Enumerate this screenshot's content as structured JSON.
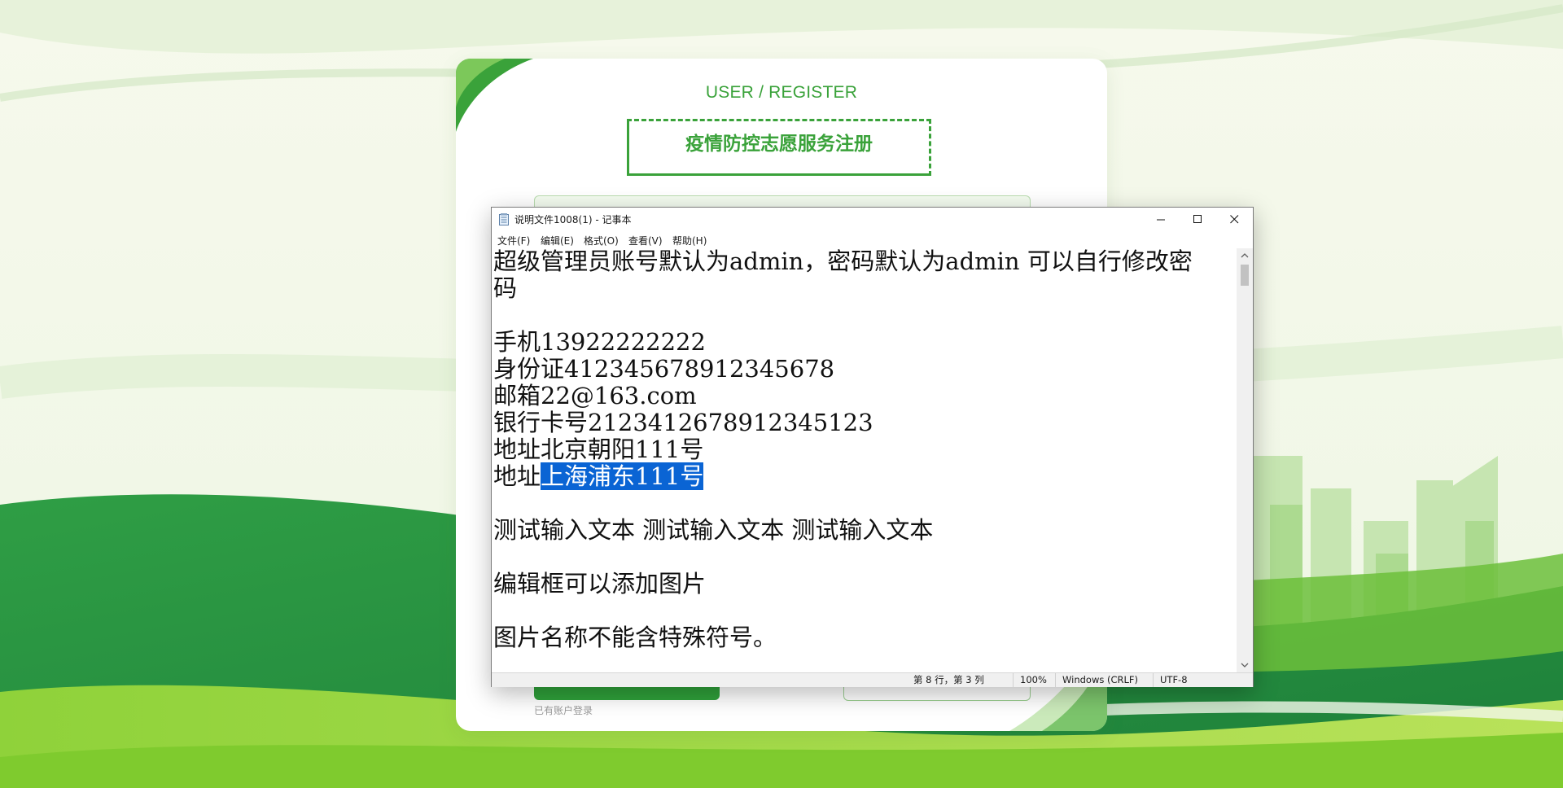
{
  "register": {
    "subtitle": "USER / REGISTER",
    "title": "疫情防控志愿服务注册",
    "login_link": "已有账户登录"
  },
  "notepad": {
    "window_title": "说明文件1008(1) - 记事本",
    "menu": [
      "文件(F)",
      "编辑(E)",
      "格式(O)",
      "查看(V)",
      "帮助(H)"
    ],
    "lines": {
      "l1": "超级管理员账号默认为admin，密码默认为admin 可以自行修改密",
      "l2": "码",
      "l3": "",
      "l4": "手机13922222222",
      "l5": "身份证412345678912345678",
      "l6": "邮箱22@163.com",
      "l7": "银行卡号2123412678912345123",
      "l8": "地址北京朝阳111号",
      "l9_prefix": "地址",
      "l9_selected": "上海浦东111号",
      "l10": "",
      "l11": "测试输入文本 测试输入文本 测试输入文本",
      "l12": "",
      "l13": "编辑框可以添加图片",
      "l14": "",
      "l15": "图片名称不能含特殊符号。"
    },
    "status": {
      "position": "第 8 行，第 3 列",
      "zoom": "100%",
      "line_ending": "Windows (CRLF)",
      "encoding": "UTF-8"
    }
  },
  "colors": {
    "brand_green": "#3aa23a",
    "selection": "#0a64d4"
  }
}
